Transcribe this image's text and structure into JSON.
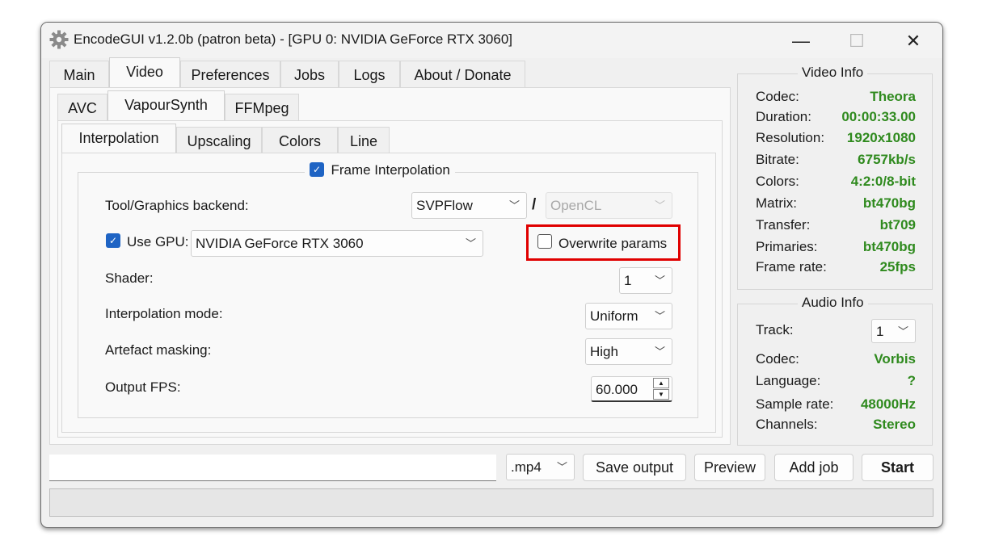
{
  "window": {
    "title": "EncodeGUI v1.2.0b (patron beta) - [GPU 0: NVIDIA GeForce RTX 3060]",
    "minimize": "—",
    "maximize": "☐",
    "close": "✕"
  },
  "main_tabs": [
    "Main",
    "Video",
    "Preferences",
    "Jobs",
    "Logs",
    "About / Donate"
  ],
  "video_tabs": [
    "AVC",
    "VapourSynth",
    "FFMpeg"
  ],
  "vs_tabs": [
    "Interpolation",
    "Upscaling",
    "Colors",
    "Line"
  ],
  "interp": {
    "group_title": "Frame Interpolation",
    "backend_label": "Tool/Graphics backend:",
    "backend_tool": "SVPFlow",
    "separator": "/",
    "backend_api": "OpenCL",
    "use_gpu_label": "Use GPU:",
    "gpu": "NVIDIA GeForce RTX 3060",
    "overwrite_label": "Overwrite params",
    "shader_label": "Shader:",
    "shader": "1",
    "mode_label": "Interpolation mode:",
    "mode": "Uniform",
    "mask_label": "Artefact masking:",
    "mask": "High",
    "fps_label": "Output FPS:",
    "fps": "60.000"
  },
  "video_info": {
    "title": "Video Info",
    "rows": [
      {
        "label": "Codec:",
        "value": "Theora"
      },
      {
        "label": "Duration:",
        "value": "00:00:33.00"
      },
      {
        "label": "Resolution:",
        "value": "1920x1080"
      },
      {
        "label": "Bitrate:",
        "value": "6757kb/s"
      },
      {
        "label": "Colors:",
        "value": "4:2:0/8-bit"
      },
      {
        "label": "Matrix:",
        "value": "bt470bg"
      },
      {
        "label": "Transfer:",
        "value": "bt709"
      },
      {
        "label": "Primaries:",
        "value": "bt470bg"
      },
      {
        "label": "Frame rate:",
        "value": "25fps"
      }
    ]
  },
  "audio_info": {
    "title": "Audio Info",
    "track_label": "Track:",
    "track": "1",
    "rows": [
      {
        "label": "Codec:",
        "value": "Vorbis"
      },
      {
        "label": "Language:",
        "value": "?"
      },
      {
        "label": "Sample rate:",
        "value": "48000Hz"
      },
      {
        "label": "Channels:",
        "value": "Stereo"
      }
    ]
  },
  "bottom": {
    "output_path": "",
    "container": ".mp4",
    "save_output": "Save output",
    "preview": "Preview",
    "add_job": "Add job",
    "start": "Start"
  },
  "colors": {
    "info_value": "#2f8a1e",
    "highlight": "#e00000",
    "checkbox": "#1f64c4"
  },
  "icons": {
    "app": "gear-icon",
    "chevron": "chevron-down-icon"
  }
}
